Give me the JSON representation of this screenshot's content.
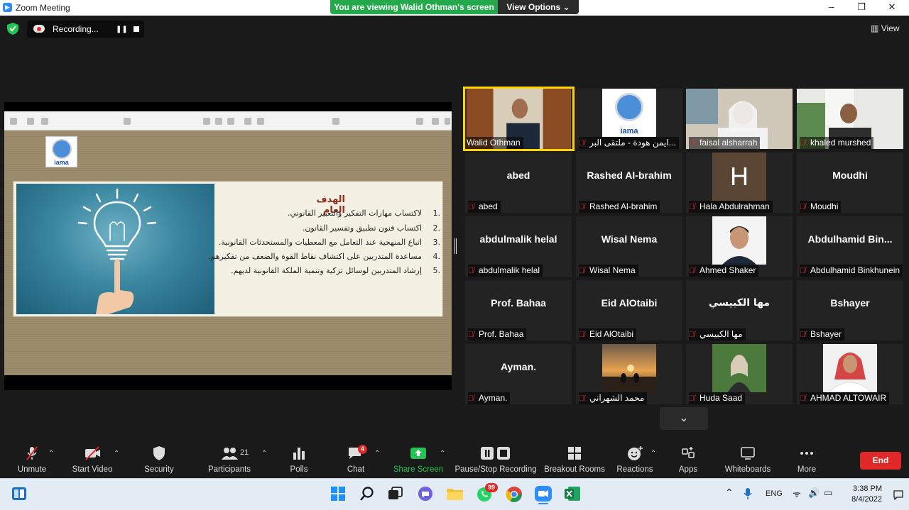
{
  "window": {
    "title": "Zoom Meeting",
    "viewing_banner": "You are viewing Walid Othman's screen",
    "view_options": "View Options",
    "view_options_chevron": "⌄"
  },
  "window_controls": {
    "minimize": "–",
    "maximize": "❐",
    "close": "✕"
  },
  "recording": {
    "label": "Recording...",
    "pause": "❚❚"
  },
  "view_button": "View",
  "slide": {
    "logo_text": "iama",
    "title": "الهدف العام",
    "items": [
      {
        "num": "1.",
        "text": "لاكتساب مهارات التفكير والتعبير القانوني."
      },
      {
        "num": "2.",
        "text": "اكتساب فنون تطبيق وتفسير القانون."
      },
      {
        "num": "3.",
        "text": "اتباع المنهجية عند التعامل مع المعطيات والمستحدثات القانونية."
      },
      {
        "num": "4.",
        "text": "مساعدة المتدربين على اكتشاف نقاط القوة والضعف من تفكيرهم."
      },
      {
        "num": "5.",
        "text": "إرشاد المتدربين لوسائل تزكية وتنمية الملكة القانونية لديهم."
      }
    ]
  },
  "participants": [
    {
      "big": "",
      "name": "Walid Othman",
      "muted": false,
      "type": "video"
    },
    {
      "big": "",
      "name": "ايمن هودة - ملتقى البر...",
      "muted": true,
      "type": "logo"
    },
    {
      "big": "",
      "name": "faisal alsharrah",
      "muted": true,
      "type": "video"
    },
    {
      "big": "",
      "name": "khaled murshed",
      "muted": true,
      "type": "video"
    },
    {
      "big": "abed",
      "name": "abed",
      "muted": true,
      "type": "text"
    },
    {
      "big": "Rashed Al-brahim",
      "name": "Rashed Al-brahim",
      "muted": true,
      "type": "text"
    },
    {
      "big": "H",
      "name": "Hala Abdulrahman",
      "muted": true,
      "type": "letter"
    },
    {
      "big": "Moudhi",
      "name": "Moudhi",
      "muted": true,
      "type": "text"
    },
    {
      "big": "abdulmalik helal",
      "name": "abdulmalik helal",
      "muted": true,
      "type": "text"
    },
    {
      "big": "Wisal Nema",
      "name": "Wisal Nema",
      "muted": true,
      "type": "text"
    },
    {
      "big": "",
      "name": "Ahmed Shaker",
      "muted": true,
      "type": "photo"
    },
    {
      "big": "Abdulhamid  Bin...",
      "name": "Abdulhamid Binkhunein",
      "muted": true,
      "type": "text"
    },
    {
      "big": "Prof. Bahaa",
      "name": "Prof. Bahaa",
      "muted": true,
      "type": "text"
    },
    {
      "big": "Eid AlOtaibi",
      "name": "Eid AlOtaibi",
      "muted": true,
      "type": "text"
    },
    {
      "big": "مها الكبيسي",
      "name": "مها الكبيسي",
      "muted": true,
      "type": "text"
    },
    {
      "big": "Bshayer",
      "name": "Bshayer",
      "muted": true,
      "type": "text"
    },
    {
      "big": "Ayman.",
      "name": "Ayman.",
      "muted": true,
      "type": "text"
    },
    {
      "big": "",
      "name": "محمد الشهراني",
      "muted": true,
      "type": "photo"
    },
    {
      "big": "",
      "name": "Huda Saad",
      "muted": true,
      "type": "photo"
    },
    {
      "big": "",
      "name": "AHMAD ALTOWAIR",
      "muted": true,
      "type": "photo"
    }
  ],
  "toolbar": {
    "unmute": "Unmute",
    "start_video": "Start Video",
    "security": "Security",
    "participants": "Participants",
    "participants_count": "21",
    "polls": "Polls",
    "chat": "Chat",
    "chat_badge": "4",
    "share_screen": "Share Screen",
    "pause_stop_recording": "Pause/Stop Recording",
    "breakout_rooms": "Breakout Rooms",
    "reactions": "Reactions",
    "apps": "Apps",
    "whiteboards": "Whiteboards",
    "more": "More",
    "end": "End"
  },
  "taskbar": {
    "whatsapp_badge": "99",
    "language": "ENG",
    "time": "3:38 PM",
    "date": "8/4/2022"
  },
  "colors": {
    "active_speaker": "#ffd400",
    "share_green": "#23a84b",
    "end_red": "#e02828"
  }
}
